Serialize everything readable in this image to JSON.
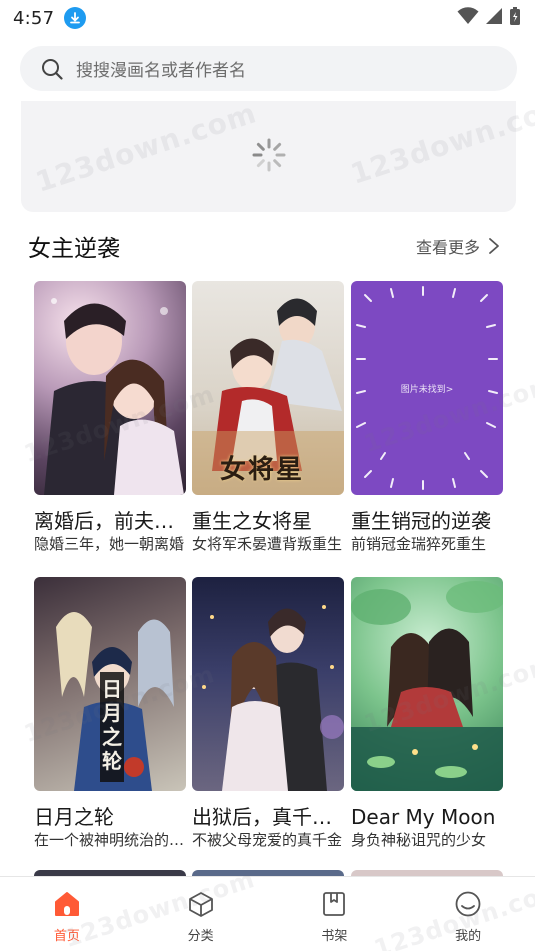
{
  "status": {
    "time": "4:57",
    "accent_color": "#1e9bf0"
  },
  "search": {
    "placeholder": "搜搜漫画名或者作者名"
  },
  "watermark_text": "123down.com",
  "section": {
    "title": "女主逆袭",
    "more_label": "查看更多"
  },
  "comics": [
    {
      "title": "离婚后，前夫他追妻火葬场",
      "desc": "隐婚三年，她一朝离婚"
    },
    {
      "title": "重生之女将星",
      "desc": "女将军禾晏遭背叛重生"
    },
    {
      "title": "重生销冠的逆袭",
      "desc": "前销冠金瑞猝死重生"
    },
    {
      "title": "日月之轮",
      "desc": "在一个被神明统治的世界"
    },
    {
      "title": "出狱后，真千金她杀疯了",
      "desc": "不被父母宠爱的真千金"
    },
    {
      "title": "Dear My Moon",
      "desc": "身负神秘诅咒的少女"
    }
  ],
  "cover_placeholder_text": "图片未找到>",
  "cover_logo_text": "女将星",
  "cover_logo_text2": "日月之轮",
  "nav": [
    {
      "label": "首页",
      "icon": "home-icon",
      "active": true
    },
    {
      "label": "分类",
      "icon": "category-cube-icon",
      "active": false
    },
    {
      "label": "书架",
      "icon": "bookshelf-icon",
      "active": false
    },
    {
      "label": "我的",
      "icon": "profile-icon",
      "active": false
    }
  ],
  "colors": {
    "active_nav": "#ff5a36",
    "placeholder_cover": "#7d49c2"
  }
}
